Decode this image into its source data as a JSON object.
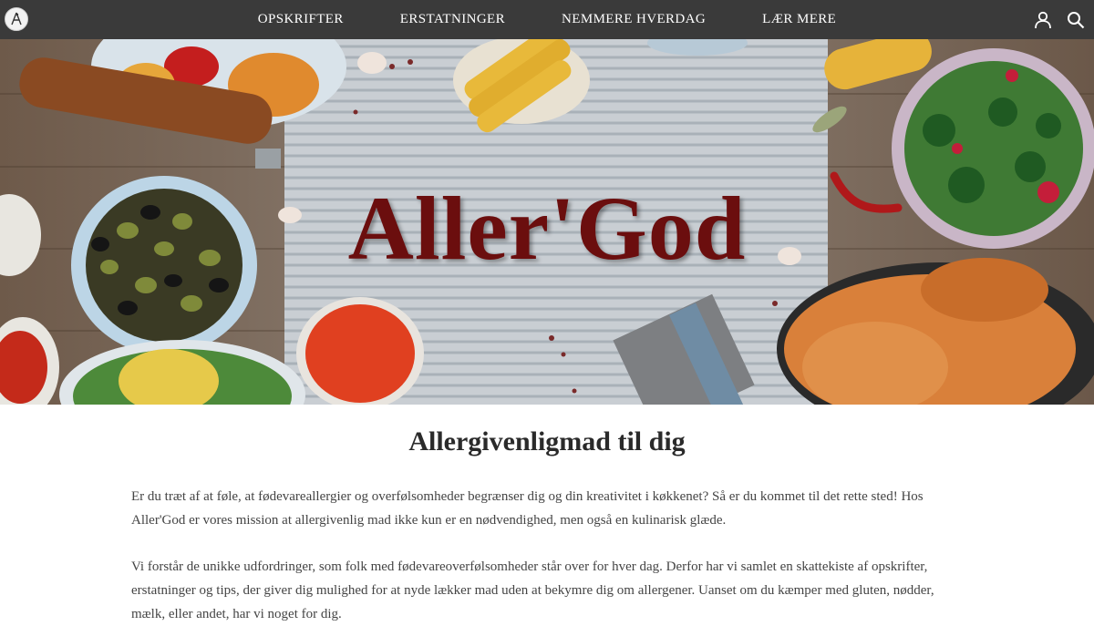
{
  "nav": {
    "links": [
      "OPSKRIFTER",
      "ERSTATNINGER",
      "NEMMERE HVERDAG",
      "LÆR MERE"
    ],
    "icons": [
      "user-icon",
      "search-icon"
    ]
  },
  "hero": {
    "title": "Aller'God"
  },
  "content": {
    "heading": "Allergivenligmad til dig",
    "paragraph1": "Er du træt af at føle, at fødevareallergier og overfølsomheder begrænser dig og din kreativitet i køkkenet? Så er du kommet til det rette sted! Hos Aller'God er vores mission at allergivenlig mad ikke kun er en nødvendighed, men også en kulinarisk glæde.",
    "paragraph2": "Vi forstår de unikke udfordringer, som folk med fødevareoverfølsomheder står over for hver dag. Derfor har vi samlet en skattekiste af opskrifter, erstatninger og tips, der giver dig mulighed for at nyde lækker mad uden at bekymre dig om allergener. Uanset om du kæmper med gluten, nødder, mælk, eller andet, har vi noget for dig."
  },
  "colors": {
    "nav_bg": "#3a3a3a",
    "title_color": "#6b0e0e"
  }
}
